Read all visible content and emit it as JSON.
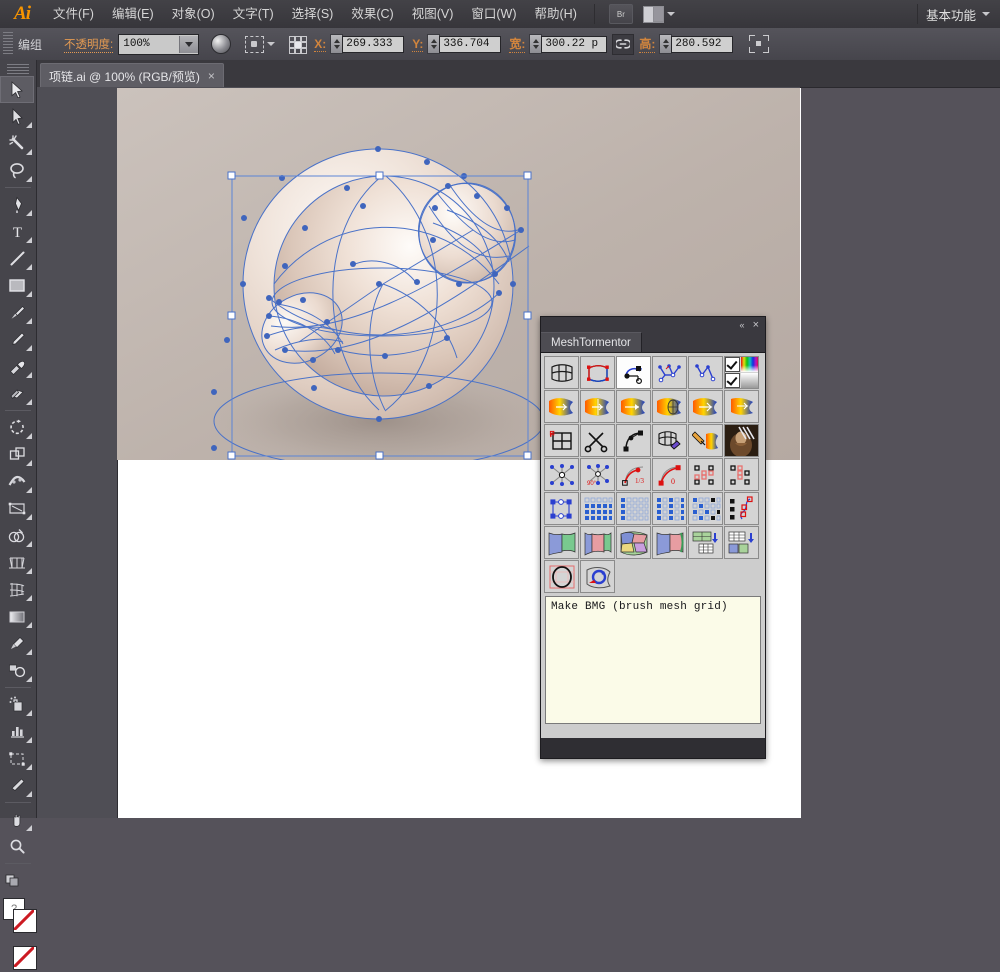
{
  "app": {
    "logo": "Ai",
    "workspace_label": "基本功能",
    "bridge_label": "Br"
  },
  "menubar": {
    "items": [
      {
        "label": "文件(F)",
        "name": "menu-file"
      },
      {
        "label": "编辑(E)",
        "name": "menu-edit"
      },
      {
        "label": "对象(O)",
        "name": "menu-object"
      },
      {
        "label": "文字(T)",
        "name": "menu-type"
      },
      {
        "label": "选择(S)",
        "name": "menu-select"
      },
      {
        "label": "效果(C)",
        "name": "menu-effect"
      },
      {
        "label": "视图(V)",
        "name": "menu-view"
      },
      {
        "label": "窗口(W)",
        "name": "menu-window"
      },
      {
        "label": "帮助(H)",
        "name": "menu-help"
      }
    ]
  },
  "controlbar": {
    "selection_label": "编组",
    "opacity_label": "不透明度:",
    "opacity_value": "100%",
    "x_label": "X:",
    "x_value": "269.333",
    "y_label": "Y:",
    "y_value": "336.704",
    "w_label": "宽:",
    "w_value": "300.22 p",
    "h_label": "高:",
    "h_value": "280.592",
    "link_icon": "link-icon"
  },
  "tab": {
    "title": "项链.ai @ 100% (RGB/预览)",
    "close": "×"
  },
  "toolbar": {
    "tools": [
      {
        "name": "selection-tool",
        "label": "选择工具",
        "active": true
      },
      {
        "name": "direct-selection-tool",
        "label": "直接选择工具"
      },
      {
        "name": "magic-wand-tool",
        "label": "魔棒工具"
      },
      {
        "name": "lasso-tool",
        "label": "套索工具"
      },
      {
        "name": "pen-tool",
        "label": "钢笔工具"
      },
      {
        "name": "type-tool",
        "label": "文字工具"
      },
      {
        "name": "line-segment-tool",
        "label": "直线段工具"
      },
      {
        "name": "rectangle-tool",
        "label": "矩形工具"
      },
      {
        "name": "paintbrush-tool",
        "label": "画笔工具"
      },
      {
        "name": "pencil-tool",
        "label": "铅笔工具"
      },
      {
        "name": "blob-brush-tool",
        "label": "斑点画笔工具"
      },
      {
        "name": "eraser-tool",
        "label": "橡皮擦工具"
      },
      {
        "name": "rotate-tool",
        "label": "旋转工具"
      },
      {
        "name": "scale-tool",
        "label": "比例缩放工具"
      },
      {
        "name": "width-tool",
        "label": "变形工具"
      },
      {
        "name": "free-transform-tool",
        "label": "自由变换工具"
      },
      {
        "name": "shape-builder-tool",
        "label": "形状生成器工具"
      },
      {
        "name": "perspective-grid-tool",
        "label": "透视网格工具"
      },
      {
        "name": "mesh-tool",
        "label": "网格工具"
      },
      {
        "name": "gradient-tool",
        "label": "渐变工具"
      },
      {
        "name": "eyedropper-tool",
        "label": "吸管工具"
      },
      {
        "name": "blend-tool",
        "label": "混合工具"
      },
      {
        "name": "symbol-sprayer-tool",
        "label": "符号喷枪工具"
      },
      {
        "name": "column-graph-tool",
        "label": "柱形图工具"
      },
      {
        "name": "artboard-tool",
        "label": "画板工具"
      },
      {
        "name": "slice-tool",
        "label": "切片工具"
      },
      {
        "name": "hand-tool",
        "label": "抓手工具"
      },
      {
        "name": "zoom-tool",
        "label": "缩放工具"
      }
    ],
    "fill_color": "#ffffff",
    "stroke_color": "#ffffff",
    "help_label": "?"
  },
  "panel": {
    "title": "MeshTormentor",
    "collapse_icon": "«",
    "close_icon": "×",
    "status_text": "Make BMG (brush mesh grid)",
    "checkbox_1_checked": true,
    "checkbox_2_checked": true,
    "rows": [
      {
        "cells": [
          {
            "name": "mesh-outline-button"
          },
          {
            "name": "mesh-color-edges-button"
          },
          {
            "name": "mesh-handles-button"
          },
          {
            "name": "mesh-path-split-button"
          },
          {
            "name": "mesh-path-join-button"
          },
          {
            "name": "mesh-options-checkboxes"
          }
        ]
      },
      {
        "cells": [
          {
            "name": "mesh-fish-1-button"
          },
          {
            "name": "mesh-fish-2-button"
          },
          {
            "name": "mesh-fish-3-button"
          },
          {
            "name": "mesh-fish-4-button"
          },
          {
            "name": "mesh-fish-5-button"
          },
          {
            "name": "mesh-fish-6-button"
          }
        ]
      },
      {
        "cells": [
          {
            "name": "make-bmg-button"
          },
          {
            "name": "mesh-scissors-button"
          },
          {
            "name": "mesh-curve-button"
          },
          {
            "name": "mesh-brush-button"
          },
          {
            "name": "mesh-paint-button"
          },
          {
            "name": "mesh-image-button"
          }
        ]
      },
      {
        "cells": [
          {
            "name": "mesh-star-node-button"
          },
          {
            "name": "mesh-rotate-90-button"
          },
          {
            "name": "mesh-third-handle-button"
          },
          {
            "name": "mesh-zero-handle-button"
          },
          {
            "name": "mesh-select-pattern-1-button"
          },
          {
            "name": "mesh-select-pattern-2-button"
          }
        ]
      },
      {
        "cells": [
          {
            "name": "mesh-corner-nodes-button"
          },
          {
            "name": "mesh-grid-select-1-button"
          },
          {
            "name": "mesh-grid-select-2-button"
          },
          {
            "name": "mesh-grid-select-3-button"
          },
          {
            "name": "mesh-grid-select-4-button"
          },
          {
            "name": "mesh-path-nodes-button"
          }
        ]
      },
      {
        "cells": [
          {
            "name": "mesh-fold-blue-button"
          },
          {
            "name": "mesh-fold-pink-button"
          },
          {
            "name": "mesh-patchwork-button"
          },
          {
            "name": "mesh-two-panel-button"
          },
          {
            "name": "mesh-split-grid-button"
          },
          {
            "name": "mesh-merge-grid-button"
          }
        ]
      },
      {
        "cells": [
          {
            "name": "mesh-circle-fit-button"
          },
          {
            "name": "mesh-warp-rotate-button"
          }
        ]
      }
    ]
  },
  "canvas": {
    "artwork_name": "pearl-sphere-mesh-artwork",
    "zoom": "100%"
  }
}
